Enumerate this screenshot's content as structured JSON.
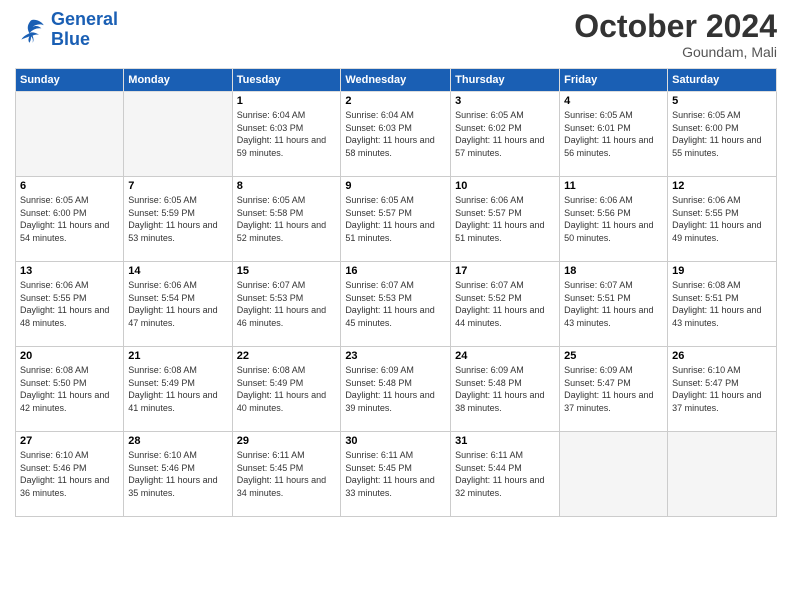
{
  "logo": {
    "line1": "General",
    "line2": "Blue"
  },
  "title": "October 2024",
  "location": "Goundam, Mali",
  "days_of_week": [
    "Sunday",
    "Monday",
    "Tuesday",
    "Wednesday",
    "Thursday",
    "Friday",
    "Saturday"
  ],
  "weeks": [
    [
      {
        "day": "",
        "empty": true
      },
      {
        "day": "",
        "empty": true
      },
      {
        "day": "1",
        "sunrise": "6:04 AM",
        "sunset": "6:03 PM",
        "daylight": "11 hours and 59 minutes."
      },
      {
        "day": "2",
        "sunrise": "6:04 AM",
        "sunset": "6:03 PM",
        "daylight": "11 hours and 58 minutes."
      },
      {
        "day": "3",
        "sunrise": "6:05 AM",
        "sunset": "6:02 PM",
        "daylight": "11 hours and 57 minutes."
      },
      {
        "day": "4",
        "sunrise": "6:05 AM",
        "sunset": "6:01 PM",
        "daylight": "11 hours and 56 minutes."
      },
      {
        "day": "5",
        "sunrise": "6:05 AM",
        "sunset": "6:00 PM",
        "daylight": "11 hours and 55 minutes."
      }
    ],
    [
      {
        "day": "6",
        "sunrise": "6:05 AM",
        "sunset": "6:00 PM",
        "daylight": "11 hours and 54 minutes."
      },
      {
        "day": "7",
        "sunrise": "6:05 AM",
        "sunset": "5:59 PM",
        "daylight": "11 hours and 53 minutes."
      },
      {
        "day": "8",
        "sunrise": "6:05 AM",
        "sunset": "5:58 PM",
        "daylight": "11 hours and 52 minutes."
      },
      {
        "day": "9",
        "sunrise": "6:05 AM",
        "sunset": "5:57 PM",
        "daylight": "11 hours and 51 minutes."
      },
      {
        "day": "10",
        "sunrise": "6:06 AM",
        "sunset": "5:57 PM",
        "daylight": "11 hours and 51 minutes."
      },
      {
        "day": "11",
        "sunrise": "6:06 AM",
        "sunset": "5:56 PM",
        "daylight": "11 hours and 50 minutes."
      },
      {
        "day": "12",
        "sunrise": "6:06 AM",
        "sunset": "5:55 PM",
        "daylight": "11 hours and 49 minutes."
      }
    ],
    [
      {
        "day": "13",
        "sunrise": "6:06 AM",
        "sunset": "5:55 PM",
        "daylight": "11 hours and 48 minutes."
      },
      {
        "day": "14",
        "sunrise": "6:06 AM",
        "sunset": "5:54 PM",
        "daylight": "11 hours and 47 minutes."
      },
      {
        "day": "15",
        "sunrise": "6:07 AM",
        "sunset": "5:53 PM",
        "daylight": "11 hours and 46 minutes."
      },
      {
        "day": "16",
        "sunrise": "6:07 AM",
        "sunset": "5:53 PM",
        "daylight": "11 hours and 45 minutes."
      },
      {
        "day": "17",
        "sunrise": "6:07 AM",
        "sunset": "5:52 PM",
        "daylight": "11 hours and 44 minutes."
      },
      {
        "day": "18",
        "sunrise": "6:07 AM",
        "sunset": "5:51 PM",
        "daylight": "11 hours and 43 minutes."
      },
      {
        "day": "19",
        "sunrise": "6:08 AM",
        "sunset": "5:51 PM",
        "daylight": "11 hours and 43 minutes."
      }
    ],
    [
      {
        "day": "20",
        "sunrise": "6:08 AM",
        "sunset": "5:50 PM",
        "daylight": "11 hours and 42 minutes."
      },
      {
        "day": "21",
        "sunrise": "6:08 AM",
        "sunset": "5:49 PM",
        "daylight": "11 hours and 41 minutes."
      },
      {
        "day": "22",
        "sunrise": "6:08 AM",
        "sunset": "5:49 PM",
        "daylight": "11 hours and 40 minutes."
      },
      {
        "day": "23",
        "sunrise": "6:09 AM",
        "sunset": "5:48 PM",
        "daylight": "11 hours and 39 minutes."
      },
      {
        "day": "24",
        "sunrise": "6:09 AM",
        "sunset": "5:48 PM",
        "daylight": "11 hours and 38 minutes."
      },
      {
        "day": "25",
        "sunrise": "6:09 AM",
        "sunset": "5:47 PM",
        "daylight": "11 hours and 37 minutes."
      },
      {
        "day": "26",
        "sunrise": "6:10 AM",
        "sunset": "5:47 PM",
        "daylight": "11 hours and 37 minutes."
      }
    ],
    [
      {
        "day": "27",
        "sunrise": "6:10 AM",
        "sunset": "5:46 PM",
        "daylight": "11 hours and 36 minutes."
      },
      {
        "day": "28",
        "sunrise": "6:10 AM",
        "sunset": "5:46 PM",
        "daylight": "11 hours and 35 minutes."
      },
      {
        "day": "29",
        "sunrise": "6:11 AM",
        "sunset": "5:45 PM",
        "daylight": "11 hours and 34 minutes."
      },
      {
        "day": "30",
        "sunrise": "6:11 AM",
        "sunset": "5:45 PM",
        "daylight": "11 hours and 33 minutes."
      },
      {
        "day": "31",
        "sunrise": "6:11 AM",
        "sunset": "5:44 PM",
        "daylight": "11 hours and 32 minutes."
      },
      {
        "day": "",
        "empty": true
      },
      {
        "day": "",
        "empty": true
      }
    ]
  ]
}
